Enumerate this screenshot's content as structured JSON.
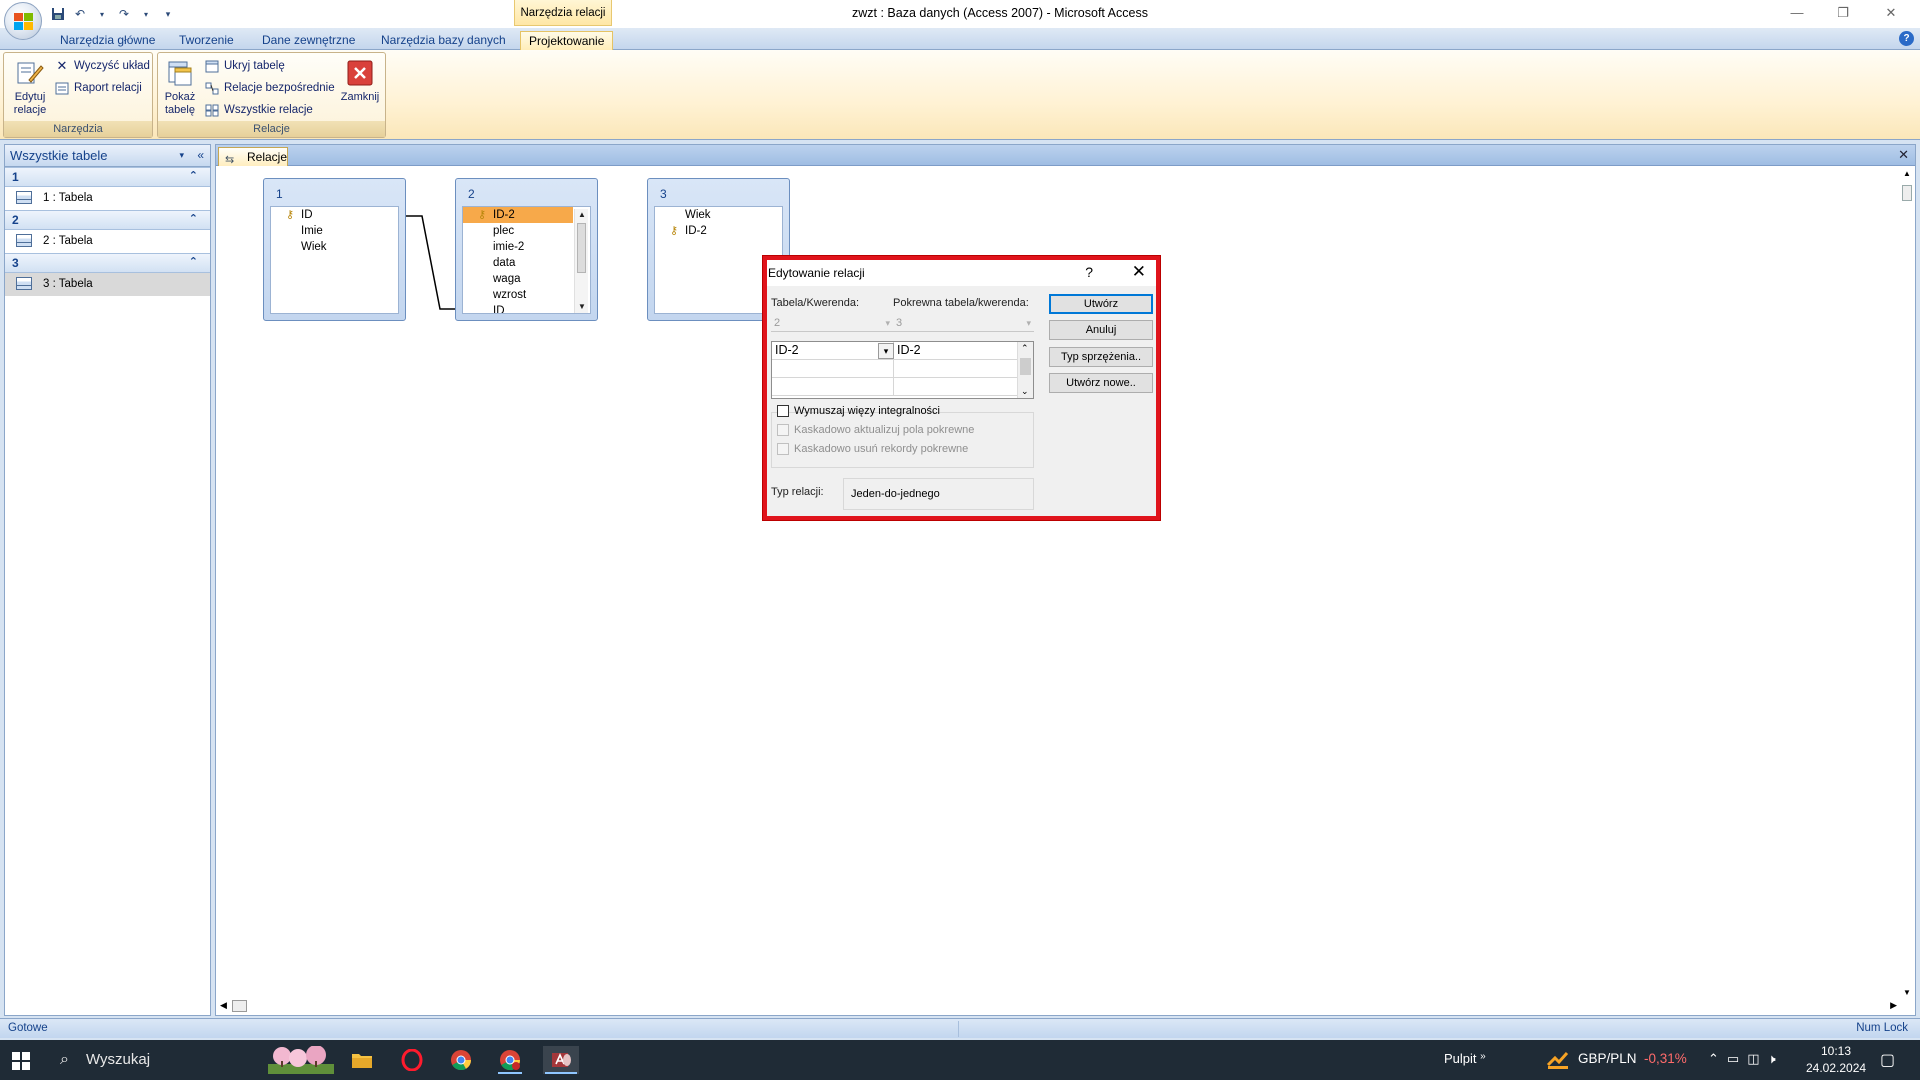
{
  "window": {
    "title": "zwzt : Baza danych (Access 2007) - Microsoft Access",
    "context_tab": "Narzędzia relacji",
    "controls": {
      "minimize": "—",
      "restore": "❐",
      "close": "✕"
    }
  },
  "ribbon": {
    "tabs": [
      "Narzędzia główne",
      "Tworzenie",
      "Dane zewnętrzne",
      "Narzędzia bazy danych",
      "Projektowanie"
    ],
    "active_tab": "Projektowanie",
    "groups": {
      "narzedzia": {
        "label": "Narzędzia",
        "edit_relations": "Edytuj relacje",
        "edit_relations_line1": "Edytuj",
        "edit_relations_line2": "relacje",
        "clear_layout": "Wyczyść układ",
        "relation_report": "Raport relacji"
      },
      "relacje": {
        "label": "Relacje",
        "show_table_line1": "Pokaż",
        "show_table_line2": "tabelę",
        "hide_table": "Ukryj tabelę",
        "direct_relations": "Relacje bezpośrednie",
        "all_relations": "Wszystkie relacje",
        "close": "Zamknij"
      }
    }
  },
  "nav_pane": {
    "title": "Wszystkie tabele",
    "groups": [
      {
        "name": "1",
        "item": "1 : Tabela"
      },
      {
        "name": "2",
        "item": "2 : Tabela"
      },
      {
        "name": "3",
        "item": "3 : Tabela"
      }
    ]
  },
  "document": {
    "tab_label": "Relacje",
    "tables": [
      {
        "name": "1",
        "fields": [
          "ID",
          "Imie",
          "Wiek"
        ]
      },
      {
        "name": "2",
        "fields": [
          "ID-2",
          "plec",
          "imie-2",
          "data",
          "waga",
          "wzrost",
          "ID"
        ]
      },
      {
        "name": "3",
        "fields": [
          "Wiek",
          "ID-2"
        ]
      }
    ]
  },
  "dialog": {
    "title": "Edytowanie relacji",
    "help": "?",
    "table_label": "Tabela/Kwerenda:",
    "related_label": "Pokrewna tabela/kwerenda:",
    "table_value": "2",
    "related_value": "3",
    "grid_left": "ID-2",
    "grid_right": "ID-2",
    "buttons": {
      "create": "Utwórz",
      "cancel": "Anuluj",
      "join_type": "Typ sprzężenia..",
      "create_new": "Utwórz nowe.."
    },
    "enforce_integrity": "Wymuszaj więzy integralności",
    "cascade_update": "Kaskadowo aktualizuj pola pokrewne",
    "cascade_delete": "Kaskadowo usuń rekordy pokrewne",
    "relation_type_label": "Typ relacji:",
    "relation_type_value": "Jeden-do-jednego"
  },
  "status_bar": {
    "left": "Gotowe",
    "right": "Num Lock"
  },
  "taskbar": {
    "search_placeholder": "Wyszukaj",
    "pulpit": "Pulpit",
    "currency_pair": "GBP/PLN",
    "currency_change": "-0,31%",
    "time": "10:13",
    "date": "24.02.2024"
  },
  "colors": {
    "highlight_field": "#f7a94a",
    "dialog_border": "#e0141c",
    "accent": "#0078d7"
  }
}
